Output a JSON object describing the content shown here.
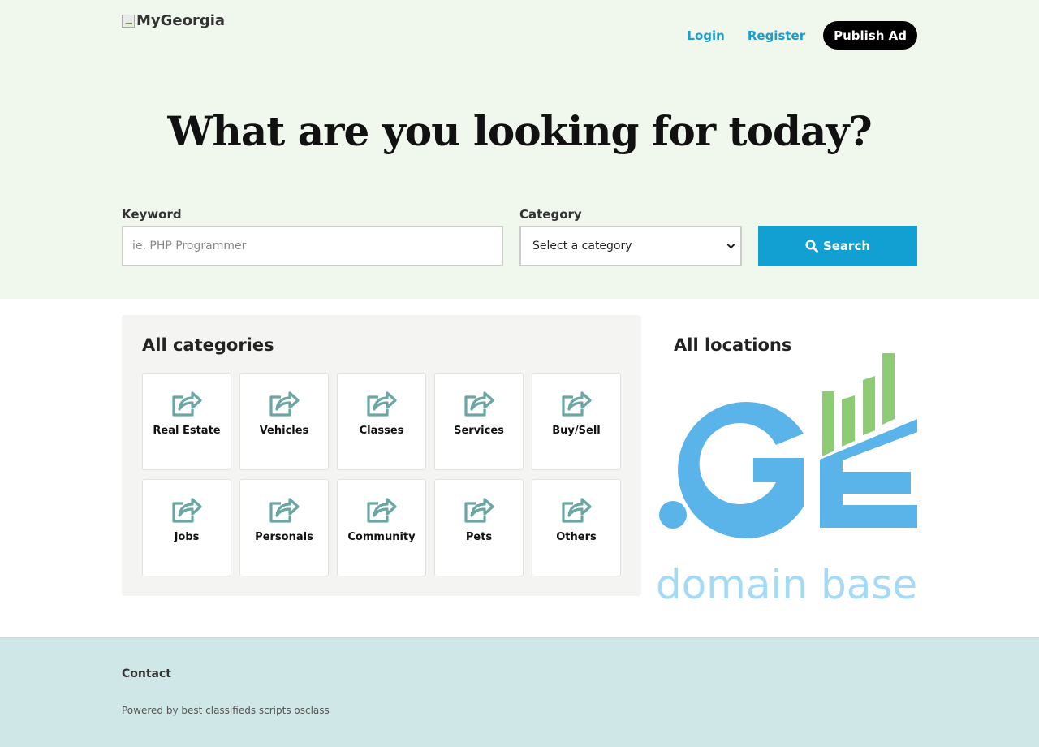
{
  "header": {
    "logo_alt": "MyGeorgia",
    "nav": {
      "login": "Login",
      "register": "Register",
      "publish": "Publish Ad"
    }
  },
  "hero": {
    "headline": "What are you looking for today?",
    "keyword_label": "Keyword",
    "keyword_placeholder": "ie. PHP Programmer",
    "keyword_value": "",
    "category_label": "Category",
    "category_selected": "Select a category",
    "search_label": "Search"
  },
  "categories": {
    "title": "All categories",
    "items": [
      {
        "label": "Real Estate",
        "icon": "share-icon"
      },
      {
        "label": "Vehicles",
        "icon": "share-icon"
      },
      {
        "label": "Classes",
        "icon": "share-icon"
      },
      {
        "label": "Services",
        "icon": "share-icon"
      },
      {
        "label": "Buy/Sell",
        "icon": "share-icon"
      },
      {
        "label": "Jobs",
        "icon": "share-icon"
      },
      {
        "label": "Personals",
        "icon": "share-icon"
      },
      {
        "label": "Community",
        "icon": "share-icon"
      },
      {
        "label": "Pets",
        "icon": "share-icon"
      },
      {
        "label": "Others",
        "icon": "share-icon"
      }
    ]
  },
  "locations": {
    "title": "All locations",
    "logo_wordmark": ".GE",
    "logo_tagline": "domain base"
  },
  "footer": {
    "contact": "Contact",
    "powered": "Powered by best classifieds scripts osclass"
  },
  "colors": {
    "hero_bg": "#f0f8ee",
    "accent": "#129fd2",
    "icon": "#6aa6a3",
    "ge_blue": "#5ab4ea",
    "ge_green": "#8dcc74",
    "footer_bg": "#d0e7e8"
  }
}
